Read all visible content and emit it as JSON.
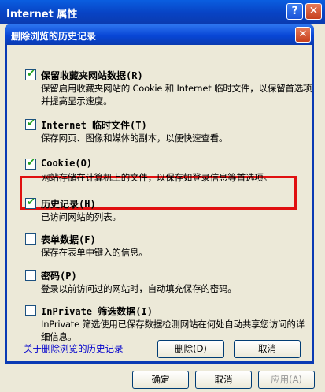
{
  "outer_window": {
    "title": "Internet 属性",
    "help_glyph": "?",
    "close_glyph": "✕",
    "buttons": {
      "ok": "确定",
      "cancel": "取消",
      "apply": "应用(A)"
    }
  },
  "dialog": {
    "title": "删除浏览的历史记录",
    "close_glyph": "✕",
    "options": [
      {
        "label": "保留收藏夹网站数据(R)",
        "checked": true,
        "description": "保留启用收藏夹网站的 Cookie 和 Internet 临时文件，以保留首选项并提高显示速度。"
      },
      {
        "label": "Internet 临时文件(T)",
        "checked": true,
        "description": "保存网页、图像和媒体的副本，以便快速查看。"
      },
      {
        "label": "Cookie(O)",
        "checked": true,
        "description": "网站存储在计算机上的文件，以保存如登录信息等首选项。"
      },
      {
        "label": "历史记录(H)",
        "checked": true,
        "description": "已访问网站的列表。"
      },
      {
        "label": "表单数据(F)",
        "checked": false,
        "description": "保存在表单中键入的信息。"
      },
      {
        "label": "密码(P)",
        "checked": false,
        "description": "登录以前访问过的网站时，自动填充保存的密码。"
      },
      {
        "label": "InPrivate 筛选数据(I)",
        "checked": false,
        "description": "InPrivate 筛选使用已保存数据检测网站在何处自动共享您访问的详细信息。"
      }
    ],
    "about_link": "关于删除浏览的历史记录",
    "delete_button": "删除(D)",
    "cancel_button": "取消"
  },
  "check_glyph": "✔",
  "colors": {
    "title_bar": "#0843c4",
    "highlight_border": "#e01010",
    "check_green": "#21a121",
    "link_blue": "#0000cc"
  }
}
